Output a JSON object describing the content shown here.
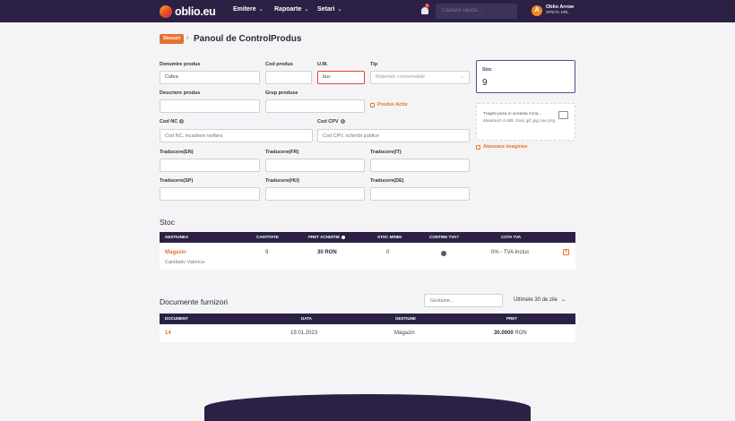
{
  "brand": {
    "name": "oblio.eu"
  },
  "nav": [
    {
      "label": "Emitere"
    },
    {
      "label": "Rapoarte"
    },
    {
      "label": "Setari"
    }
  ],
  "notifications": {
    "count": "1"
  },
  "search": {
    "placeholder": "Cautare rapida ..."
  },
  "user": {
    "initial": "A",
    "name": "Oblio Arrow",
    "company": "SPETA SRL"
  },
  "breadcrumb": {
    "badge": "Stocuri",
    "items": [
      "Panoul de Control",
      "Produs"
    ]
  },
  "form": {
    "denumire": {
      "label": "Denumire produs",
      "value": "Cafea"
    },
    "cod_produs": {
      "label": "Cod produs",
      "value": ""
    },
    "um": {
      "label": "U.M.",
      "value": "buc"
    },
    "tip": {
      "label": "Tip",
      "value": "Materiale consumabile"
    },
    "descriere": {
      "label": "Descriere produs",
      "value": ""
    },
    "grup": {
      "label": "Grup produse",
      "value": ""
    },
    "produs_activ": "Produs Activ",
    "cod_nc": {
      "label": "Cod NC",
      "placeholder": "Cod NC, incadrare tarifara"
    },
    "cod_cpv": {
      "label": "Cod CPV",
      "placeholder": "Cod CPV, schimbi publice"
    },
    "traduceri": [
      {
        "label": "Traducere(EN)"
      },
      {
        "label": "Traducere(FR)"
      },
      {
        "label": "Traducere(IT)"
      },
      {
        "label": "Traducere(SP)"
      },
      {
        "label": "Traducere(HU)"
      },
      {
        "label": "Traducere(DE)"
      }
    ]
  },
  "stoc_box": {
    "title": "Stoc",
    "value": "9"
  },
  "image_upload": {
    "line1": "Trageti poza in aceasta zona...",
    "line2": "Maximum 5 MB. Doar gif, jpg sau png.",
    "attach": "Ataseaza imaginea"
  },
  "stoc_table": {
    "title": "Stoc",
    "headers": [
      "GESTIUNEA",
      "CANTITATE",
      "PRET ACHIZITIE",
      "STOC MINIM",
      "CONTINE TVA?",
      "COTA TVA"
    ],
    "row": {
      "gestiunea": "Magazin",
      "sub": "Cantitativ Valorica",
      "cantitate": "9",
      "pret": "30 RON",
      "stoc_minim": "0",
      "cota_tva": "0% - TVA Inclus"
    }
  },
  "documente": {
    "title": "Documente furnizori",
    "filter_placeholder": "Gestiune...",
    "period": "Ultimele 30 de zile",
    "headers": [
      "DOCUMENT",
      "DATA",
      "GESTIUNE",
      "PRET"
    ],
    "row": {
      "document": "14",
      "data": "19.01.2023",
      "gestiune": "Magazin",
      "pret": "30.0000",
      "currency": "RON"
    }
  },
  "colors": {
    "header": "#2c2145",
    "accent": "#e8712c",
    "error": "#e04040"
  }
}
